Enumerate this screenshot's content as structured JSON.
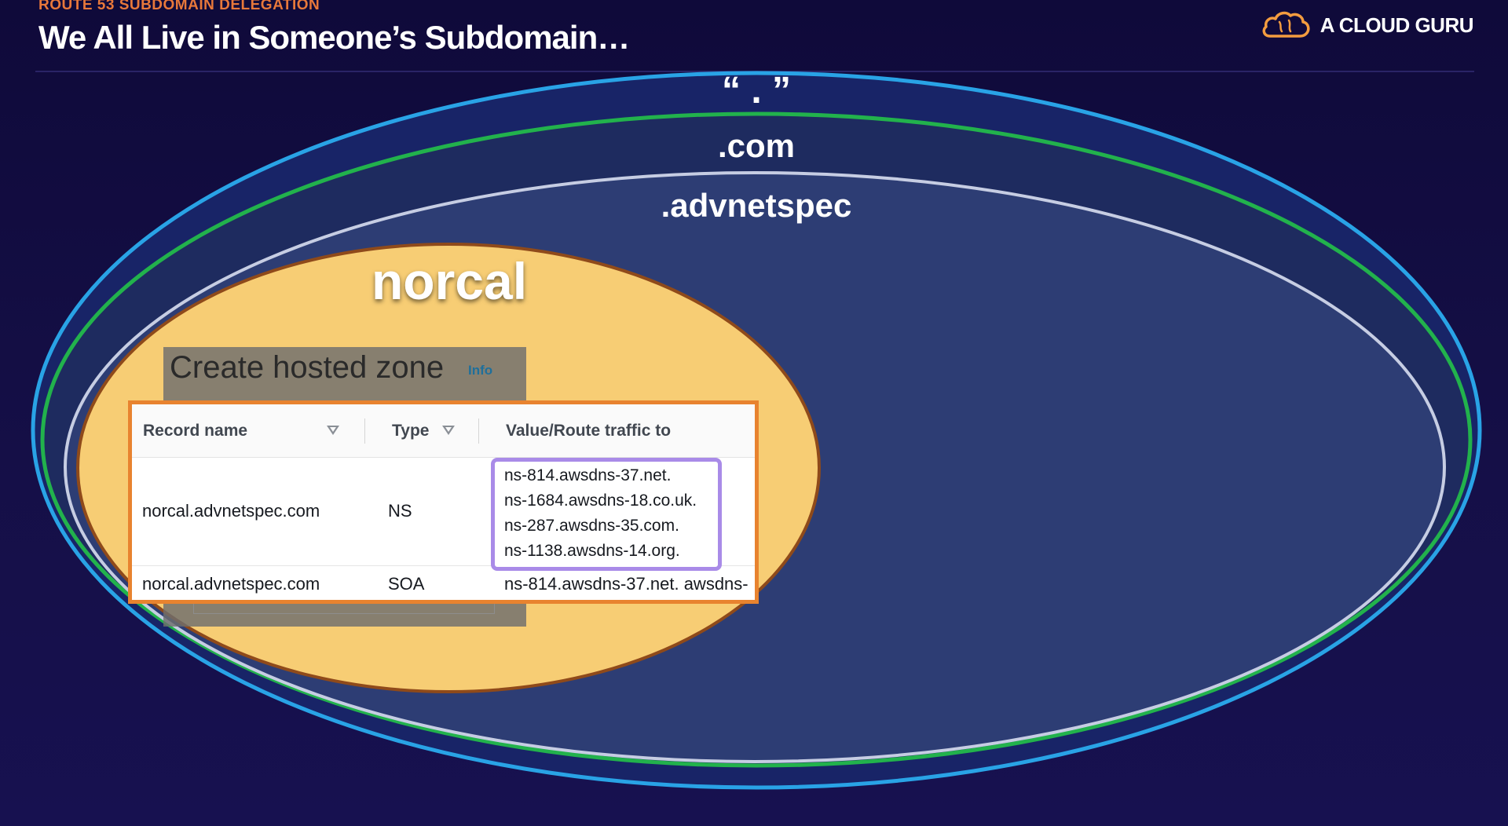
{
  "header": {
    "kicker": "ROUTE 53 SUBDOMAIN DELEGATION",
    "title": "We All Live in Someone’s Subdomain…"
  },
  "brand": {
    "name": "A CLOUD GURU",
    "icon": "cloud-logo-icon",
    "color": "#f39c3f"
  },
  "zones": {
    "root": "“ . ”",
    "com": ".com",
    "advnetspec": ".advnetspec",
    "norcal": "norcal"
  },
  "colors": {
    "root_ring": "#29a3e6",
    "com_ring": "#22b24c",
    "advnetspec_ring": "#c6cde3",
    "norcal_fill": "#f7cd74",
    "norcal_ring": "#8f4a1a",
    "records_border": "#e8832f",
    "ns_highlight": "#a98be8"
  },
  "console": {
    "heading": "Create hosted zone",
    "info_link": "Info"
  },
  "records": {
    "columns": [
      "Record name",
      "Type",
      "Value/Route traffic to"
    ],
    "rows": [
      {
        "name": "norcal.advnetspec.com",
        "type": "NS",
        "values": [
          "ns-814.awsdns-37.net.",
          "ns-1684.awsdns-18.co.uk.",
          "ns-287.awsdns-35.com.",
          "ns-1138.awsdns-14.org."
        ]
      },
      {
        "name": "norcal.advnetspec.com",
        "type": "SOA",
        "value": "ns-814.awsdns-37.net. awsdns-"
      }
    ]
  }
}
